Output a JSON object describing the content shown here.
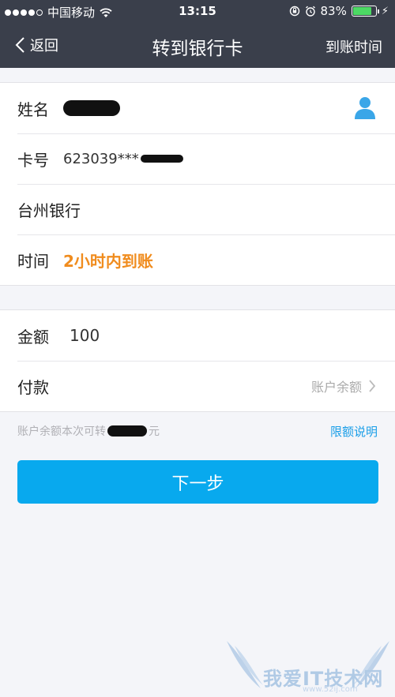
{
  "status_bar": {
    "carrier": "中国移动",
    "time": "13:15",
    "battery": "83%",
    "battery_level": 0.83
  },
  "navbar": {
    "back_label": "返回",
    "title": "转到银行卡",
    "right_label": "到账时间"
  },
  "recipient": {
    "name_label": "姓名",
    "card_label": "卡号",
    "card_number": "623039***",
    "bank_name": "台州银行",
    "time_label": "时间",
    "time_value": "2小时内到账"
  },
  "payment": {
    "amount_label": "金额",
    "amount_value": "100",
    "pay_label": "付款",
    "pay_method": "账户余额"
  },
  "hint": {
    "balance_text_prefix": "账户余额本次可转",
    "balance_text_suffix": "元",
    "limit_link": "限额说明"
  },
  "next_button": "下一步",
  "watermark": {
    "text": "我爱IT技术网",
    "sub": "www.52ij.com"
  },
  "colors": {
    "nav_bg": "#3a3f4b",
    "accent_blue": "#08a9ee",
    "link_blue": "#1a9ee8",
    "orange": "#f08c1e"
  }
}
